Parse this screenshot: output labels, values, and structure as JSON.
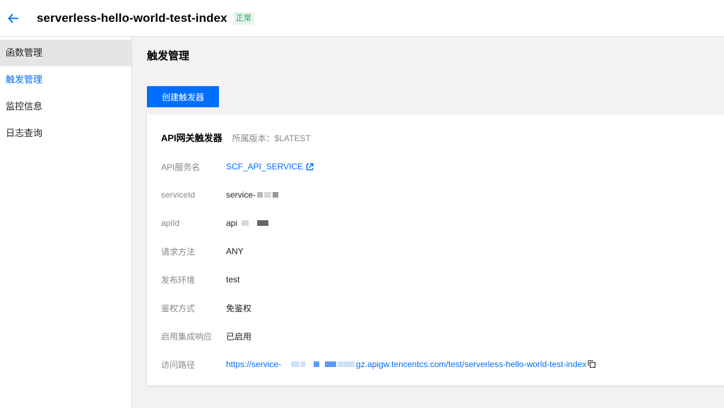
{
  "header": {
    "function_name": "serverless-hello-world-test-index",
    "status": "正常"
  },
  "sidebar": {
    "items": [
      {
        "label": "函数管理"
      },
      {
        "label": "触发管理"
      },
      {
        "label": "监控信息"
      },
      {
        "label": "日志查询"
      }
    ]
  },
  "main": {
    "page_title": "触发管理",
    "create_button": "创建触发器"
  },
  "trigger": {
    "title": "API网关触发器",
    "version": "所属版本：$LATEST",
    "rows": [
      {
        "label": "API服务名",
        "value": "SCF_API_SERVICE"
      },
      {
        "label": "serviceId",
        "value": "service-"
      },
      {
        "label": "apiId",
        "value": "api"
      },
      {
        "label": "请求方法",
        "value": "ANY"
      },
      {
        "label": "发布环境",
        "value": "test"
      },
      {
        "label": "鉴权方式",
        "value": "免鉴权"
      },
      {
        "label": "启用集成响应",
        "value": "已启用"
      },
      {
        "label": "访问路径",
        "value_prefix": "https://service-",
        "value_suffix": "gz.apigw.tencentcs.com/test/serverless-hello-world-test-index"
      }
    ]
  },
  "colors": {
    "accent": "#006eff",
    "status_bg": "#e6f6ec",
    "status_fg": "#27a05a"
  },
  "icons": {
    "back": "arrow-left-icon",
    "external_link": "external-link-icon",
    "copy": "copy-icon"
  }
}
